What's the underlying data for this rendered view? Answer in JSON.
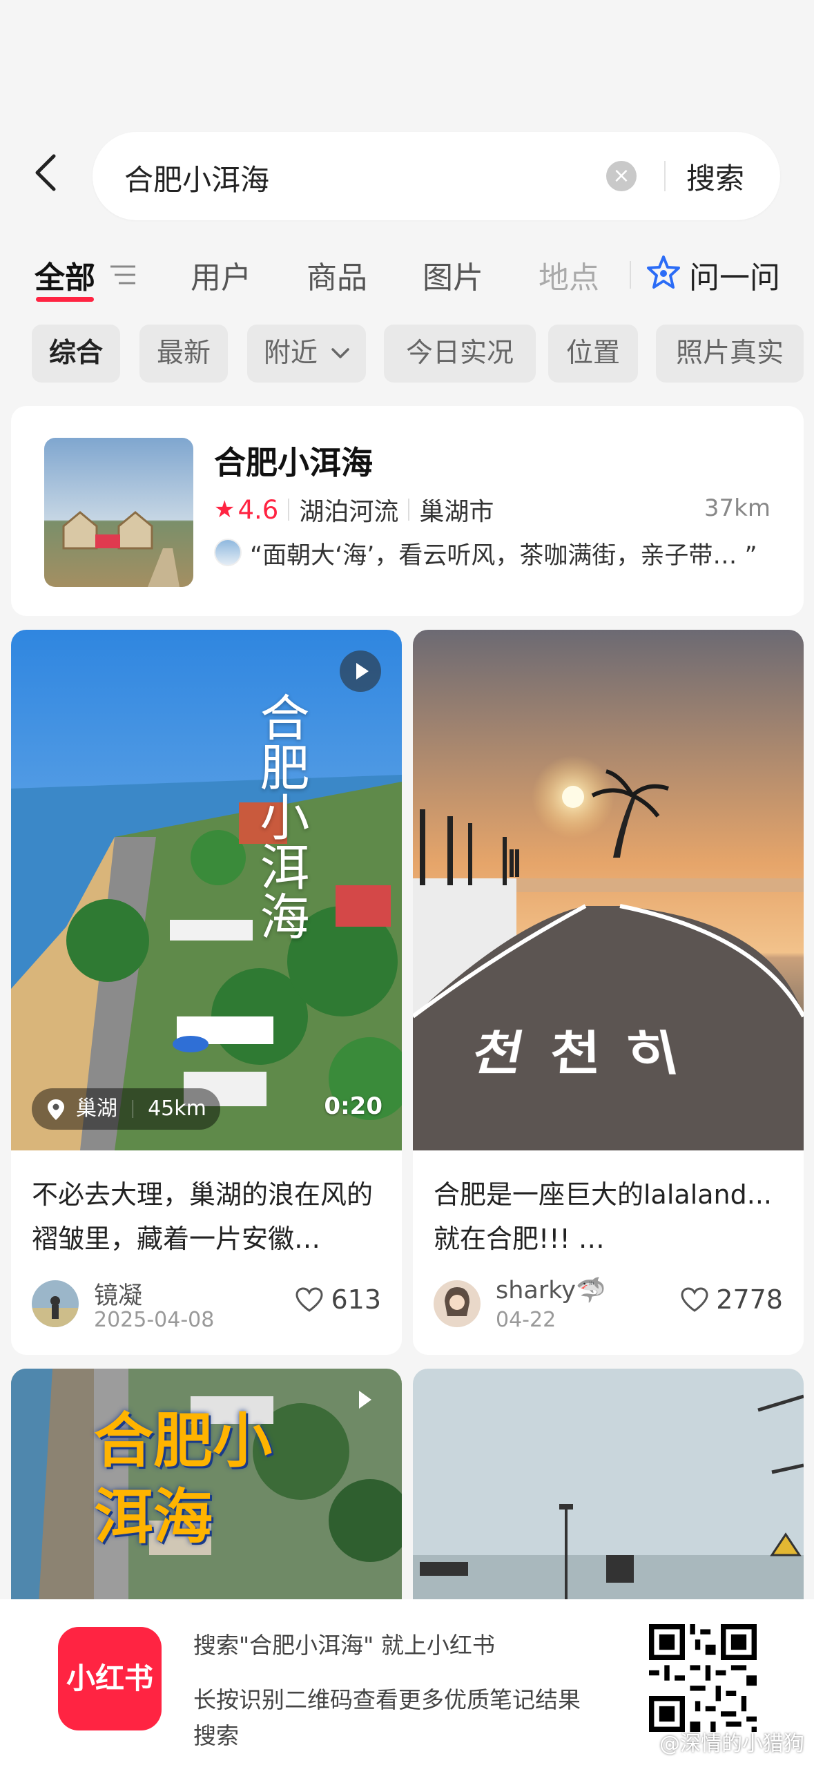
{
  "search": {
    "query": "合肥小洱海",
    "submit_label": "搜索"
  },
  "tabs": [
    {
      "label": "全部"
    },
    {
      "label": "用户"
    },
    {
      "label": "商品"
    },
    {
      "label": "图片"
    },
    {
      "label": "地点"
    },
    {
      "label": "问一问"
    }
  ],
  "chips": [
    {
      "label": "综合"
    },
    {
      "label": "最新"
    },
    {
      "label": "附近"
    },
    {
      "label": "今日实况"
    },
    {
      "label": "位置"
    },
    {
      "label": "照片真实"
    }
  ],
  "place": {
    "name": "合肥小洱海",
    "rating": "4.6",
    "category": "湖泊河流",
    "city": "巢湖市",
    "distance": "37km",
    "quote": "“面朝大‘海’，看云听风，茶咖满街，亲子带… ”"
  },
  "notes": [
    {
      "title": "不必去大理，巢湖的浪在风的褶皱里，藏着一片安徽…",
      "author": "镜凝",
      "date": "2025-04-08",
      "likes": "613",
      "location_badge": "巢湖",
      "location_distance": "45km",
      "duration": "0:20",
      "cover_text": "合肥小洱海"
    },
    {
      "title": "合肥是一座巨大的lalaland... 就在合肥!!! …",
      "author": "sharky🦈",
      "date": "04-22",
      "likes": "2778",
      "cover_text": "천천히"
    },
    {
      "cover_text": "合肥小洱海"
    },
    {}
  ],
  "banner": {
    "logo": "小红书",
    "line1": "搜索\"合肥小洱海\" 就上小红书",
    "line2": "长按识别二维码查看更多优质笔记结果搜索"
  },
  "watermark": "@深情的小猎狗"
}
